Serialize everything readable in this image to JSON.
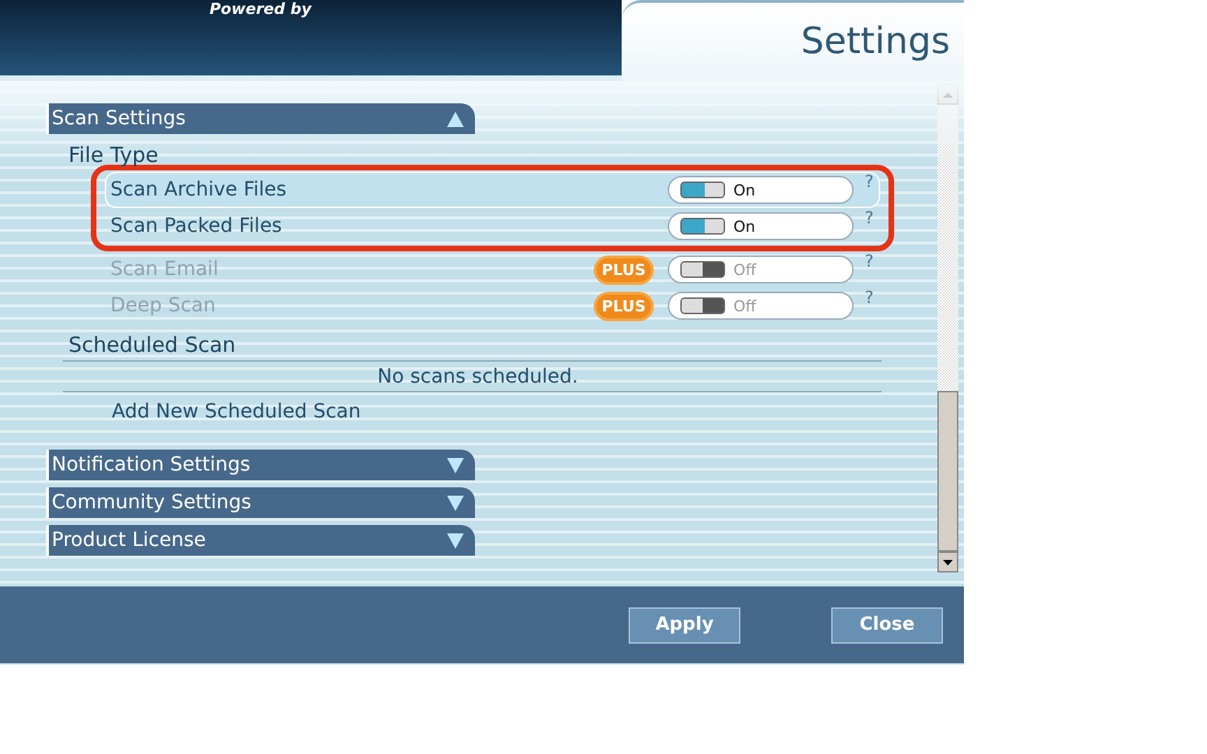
{
  "header": {
    "powered_by": "Powered by",
    "title": "Settings"
  },
  "sections": [
    {
      "title": "Scan Settings",
      "expanded": true,
      "groups": [
        {
          "kind": "options",
          "title": "File Type",
          "options": [
            {
              "label": "Scan Archive Files",
              "selected": true,
              "highlighted": true,
              "disabled": false,
              "on": true,
              "state": "On",
              "help": "?"
            },
            {
              "label": "Scan Packed Files",
              "selected": false,
              "highlighted": true,
              "disabled": false,
              "on": true,
              "state": "On",
              "help": "?"
            },
            {
              "label": "Scan Email",
              "selected": false,
              "highlighted": false,
              "disabled": true,
              "on": false,
              "state": "Off",
              "badge": "PLUS",
              "help": "?"
            },
            {
              "label": "Deep Scan",
              "selected": false,
              "highlighted": false,
              "disabled": true,
              "on": false,
              "state": "Off",
              "badge": "PLUS",
              "help": "?"
            }
          ]
        },
        {
          "kind": "schedule",
          "title": "Scheduled Scan",
          "message": "No scans scheduled.",
          "action": "Add New Scheduled Scan"
        }
      ]
    },
    {
      "title": "Notification Settings",
      "expanded": false
    },
    {
      "title": "Community Settings",
      "expanded": false
    },
    {
      "title": "Product License",
      "expanded": false
    }
  ],
  "buttons": [
    "Apply",
    "Close"
  ]
}
